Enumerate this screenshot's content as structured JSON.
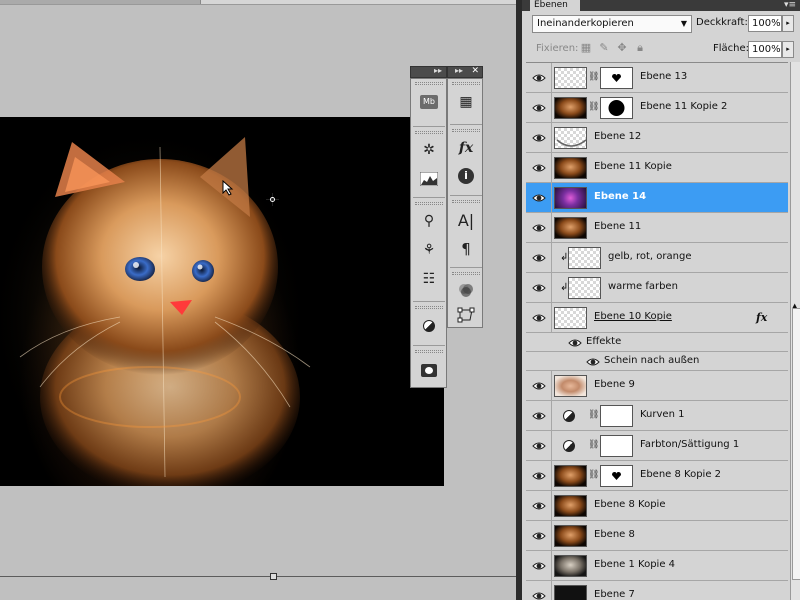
{
  "panel": {
    "tab_label": "Ebenen",
    "menu_glyph": "▾≡",
    "blend_mode": "Ineinanderkopieren",
    "opacity_label": "Deckkraft:",
    "opacity_value": "100%",
    "lock_label": "Fixieren:",
    "fill_label": "Fläche:",
    "fill_value": "100%"
  },
  "layers": [
    {
      "name": "Ebene 13",
      "thumb": "checker",
      "mask": "heart",
      "selected": false
    },
    {
      "name": "Ebene 11 Kopie 2",
      "thumb": "cat",
      "mask": "black-blob",
      "selected": false
    },
    {
      "name": "Ebene 12",
      "thumb": "checker-arc",
      "mask": null,
      "selected": false
    },
    {
      "name": "Ebene 11 Kopie",
      "thumb": "cat",
      "mask": null,
      "selected": false
    },
    {
      "name": "Ebene 14",
      "thumb": "purple",
      "mask": null,
      "selected": true
    },
    {
      "name": "Ebene 11",
      "thumb": "cat",
      "mask": null,
      "selected": false
    },
    {
      "name": "gelb, rot, orange",
      "thumb": "checker",
      "clipped": true,
      "no_eye": true
    },
    {
      "name": "warme farben",
      "thumb": "checker",
      "clipped": true,
      "no_eye": true
    },
    {
      "name": "Ebene 10 Kopie",
      "thumb": "checker",
      "fx": "fx"
    }
  ],
  "effects": {
    "label": "Effekte",
    "items": [
      "Schein nach außen"
    ]
  },
  "layers_lower": [
    {
      "name": "Ebene 9",
      "thumb": "cat-face"
    },
    {
      "name": "Kurven 1",
      "adjustment": true,
      "mask": "white"
    },
    {
      "name": "Farbton/Sättigung 1",
      "adjustment": true,
      "mask": "white"
    },
    {
      "name": "Ebene 8 Kopie 2",
      "thumb": "cat",
      "mask": "heart"
    },
    {
      "name": "Ebene 8 Kopie",
      "thumb": "cat"
    },
    {
      "name": "Ebene 8",
      "thumb": "cat"
    },
    {
      "name": "Ebene 1 Kopie 4",
      "thumb": "cat-gray"
    },
    {
      "name": "Ebene 7",
      "thumb": "dark"
    }
  ],
  "float_tools": {
    "left": [
      "mini-bridge-icon",
      "brush-presets-icon",
      "histogram-icon",
      "clone-source-icon",
      "tool-presets-icon",
      "adjustments-icon",
      "masks-icon"
    ],
    "right": [
      "navigator-icon",
      "styles-icon",
      "info-icon",
      "character-icon",
      "paragraph-icon",
      "channels-icon",
      "paths-icon"
    ],
    "mb_label": "Mb",
    "fx_label": "fx",
    "char_label": "A|",
    "para_label": "¶"
  },
  "colors": {
    "selection": "#3c9cf3",
    "panel_bg": "#d4d4d4",
    "canvas_bg": "#c0c0c0"
  }
}
